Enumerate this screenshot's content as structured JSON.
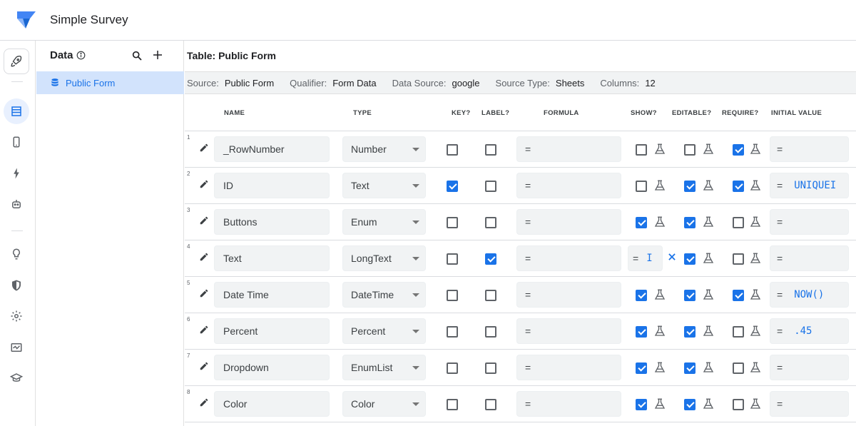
{
  "app": {
    "title": "Simple Survey"
  },
  "rail": {
    "icons": [
      "rocket-icon",
      "table-icon",
      "phone-icon",
      "bolt-icon",
      "bot-icon",
      "lightbulb-icon",
      "shield-icon",
      "gear-icon",
      "monitor-icon",
      "school-icon"
    ]
  },
  "panel": {
    "title": "Data",
    "items": [
      {
        "label": "Public Form"
      }
    ]
  },
  "table": {
    "title": "Table: Public Form",
    "source": {
      "source_key": "Source:",
      "source_val": "Public Form",
      "qualifier_key": "Qualifier:",
      "qualifier_val": "Form Data",
      "datasource_key": "Data Source:",
      "datasource_val": "google",
      "sourcetype_key": "Source Type:",
      "sourcetype_val": "Sheets",
      "columns_key": "Columns:",
      "columns_val": "12"
    },
    "headers": {
      "name": "NAME",
      "type": "TYPE",
      "key": "KEY?",
      "label": "LABEL?",
      "formula": "FORMULA",
      "show": "SHOW?",
      "editable": "EDITABLE?",
      "require": "REQUIRE?",
      "initial": "INITIAL VALUE"
    },
    "rows": [
      {
        "num": "1",
        "name": "_RowNumber",
        "type": "Number",
        "formula": "=",
        "key": false,
        "label": false,
        "show": false,
        "editable": false,
        "require": true,
        "initial_prefix": "=",
        "initial": ""
      },
      {
        "num": "2",
        "name": "ID",
        "type": "Text",
        "formula": "=",
        "key": true,
        "label": false,
        "show": false,
        "editable": true,
        "require": true,
        "initial_prefix": "=",
        "initial": "UNIQUEI"
      },
      {
        "num": "3",
        "name": "Buttons",
        "type": "Enum",
        "formula": "=",
        "key": false,
        "label": false,
        "show": true,
        "editable": true,
        "require": false,
        "initial_prefix": "=",
        "initial": ""
      },
      {
        "num": "4",
        "name": "Text",
        "type": "LongText",
        "formula": "=",
        "key": false,
        "label": true,
        "show_formula": true,
        "show_prefix": "=",
        "show_value": "I",
        "editable": true,
        "require": false,
        "initial_prefix": "=",
        "initial": ""
      },
      {
        "num": "5",
        "name": "Date Time",
        "type": "DateTime",
        "formula": "=",
        "key": false,
        "label": false,
        "show": true,
        "editable": true,
        "require": true,
        "initial_prefix": "=",
        "initial": "NOW()"
      },
      {
        "num": "6",
        "name": "Percent",
        "type": "Percent",
        "formula": "=",
        "key": false,
        "label": false,
        "show": true,
        "editable": true,
        "require": false,
        "initial_prefix": "=",
        "initial": ".45"
      },
      {
        "num": "7",
        "name": "Dropdown",
        "type": "EnumList",
        "formula": "=",
        "key": false,
        "label": false,
        "show": true,
        "editable": true,
        "require": false,
        "initial_prefix": "=",
        "initial": ""
      },
      {
        "num": "8",
        "name": "Color",
        "type": "Color",
        "formula": "=",
        "key": false,
        "label": false,
        "show": true,
        "editable": true,
        "require": false,
        "initial_prefix": "=",
        "initial": ""
      }
    ]
  },
  "colors": {
    "accent": "#1a73e8",
    "selected": "#d2e3fc",
    "field_bg": "#f1f3f4"
  }
}
